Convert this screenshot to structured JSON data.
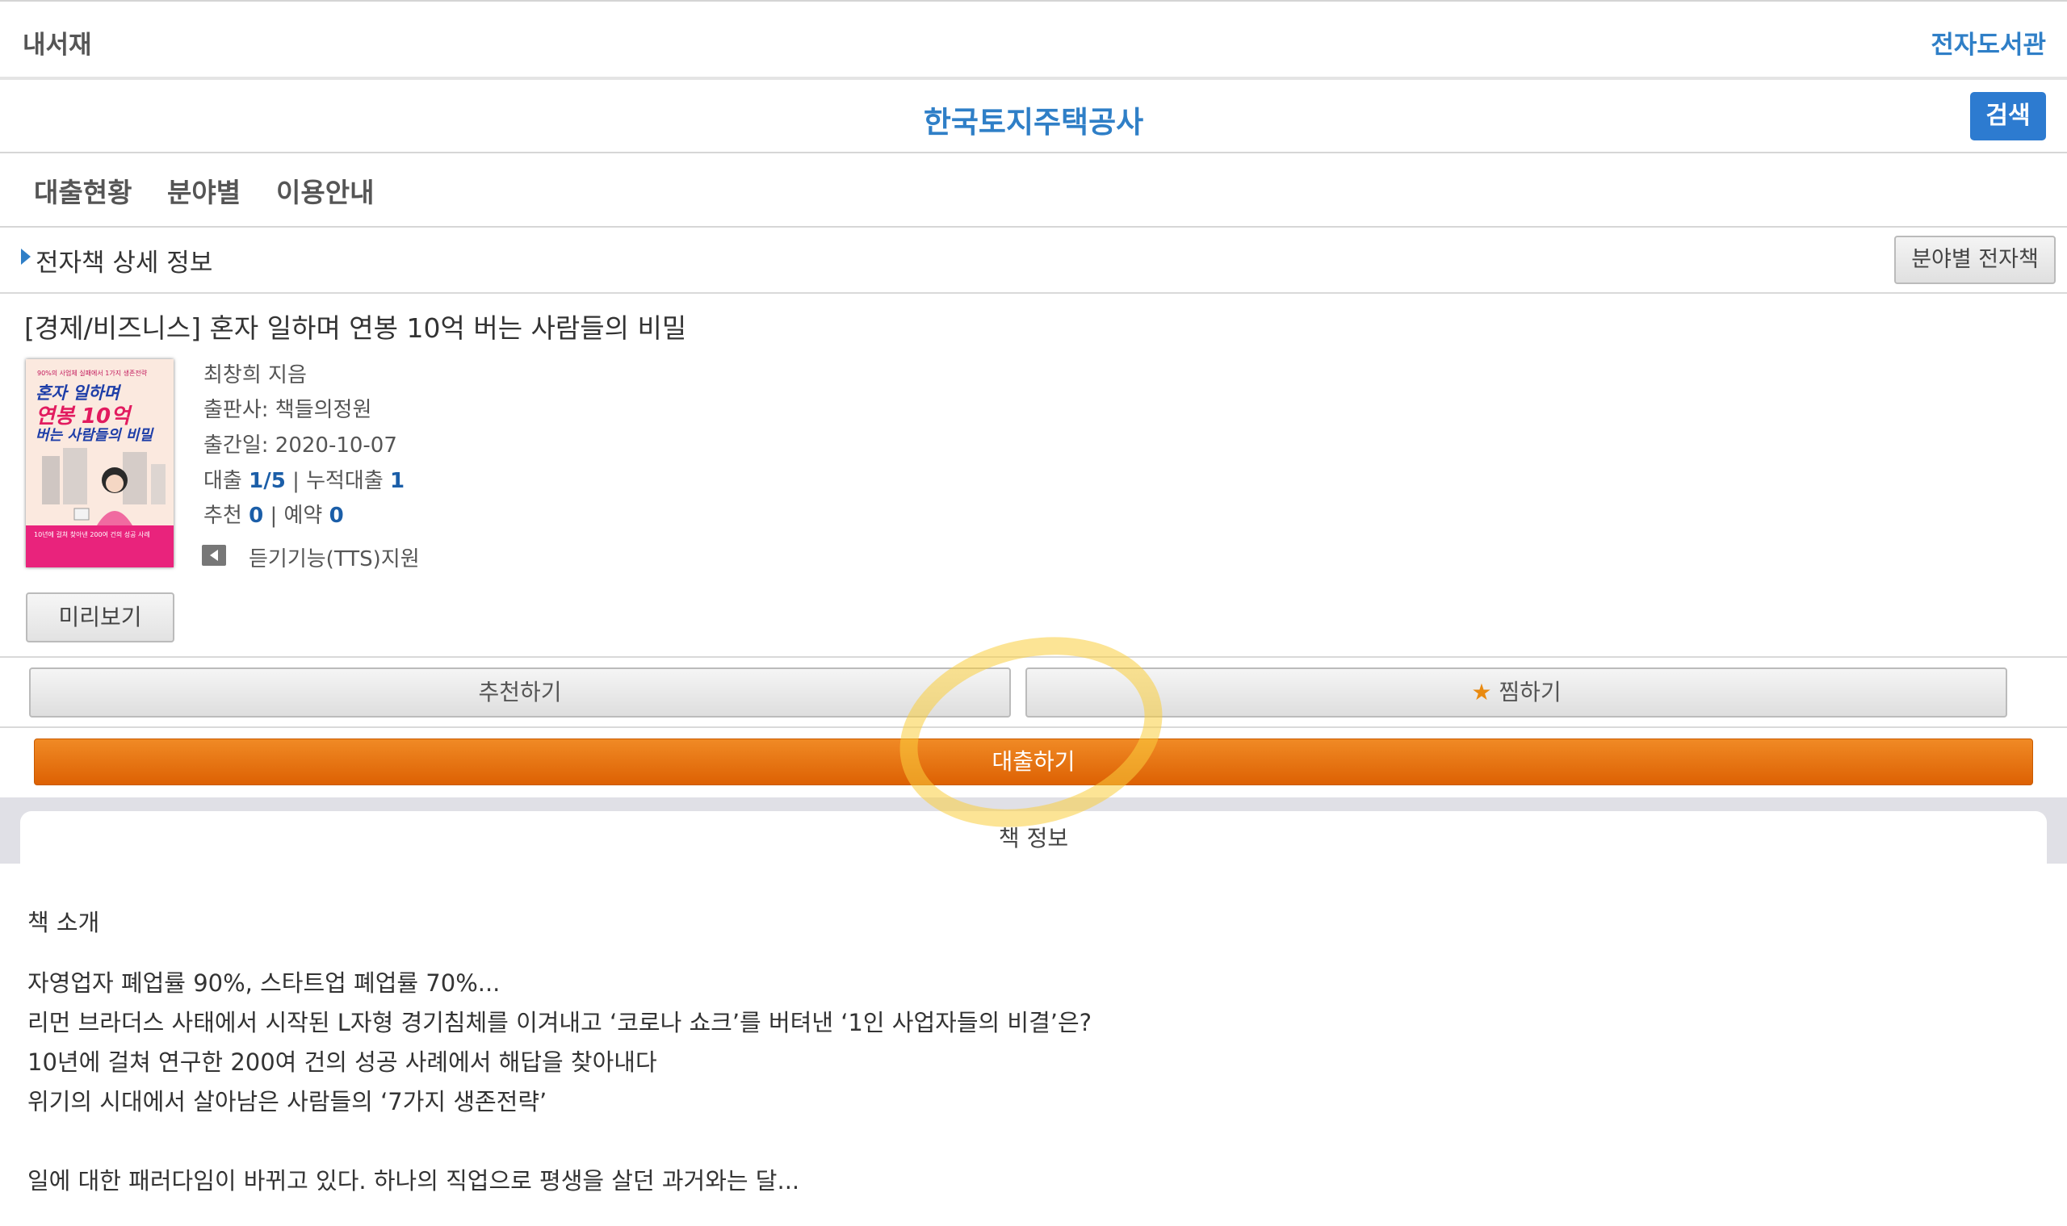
{
  "topbar": {
    "left": "내서재",
    "right": "전자도서관"
  },
  "header": {
    "title": "한국토지주택공사",
    "search_label": "검색"
  },
  "nav": {
    "items": [
      "대출현황",
      "분야별",
      "이용안내"
    ]
  },
  "section": {
    "label": "전자책 상세 정보",
    "category_button": "분야별 전자책"
  },
  "book": {
    "title": "[경제/비즈니스] 혼자 일하며 연봉 10억 버는 사람들의 비밀",
    "cover": {
      "top_text": "90%의 사업체 실패에서 1가지 생존전략",
      "line1": "혼자 일하며",
      "line2": "연봉 10억",
      "line3": "버는 사람들의 비밀",
      "bottom_text": "10년에 걸쳐 찾아낸 200여 건의 성공 사례"
    },
    "author": "최창희 지음",
    "publisher": "출판사: 책들의정원",
    "pub_date": "출간일: 2020-10-07",
    "loan_label": "대출",
    "loan_value": "1/5",
    "cumulative_label": "누적대출",
    "cumulative_value": "1",
    "recommend_label": "추천",
    "recommend_value": "0",
    "reserve_label": "예약",
    "reserve_value": "0",
    "tts": "듣기기능(TTS)지원"
  },
  "buttons": {
    "preview": "미리보기",
    "recommend": "추천하기",
    "wishlist": "찜하기",
    "borrow": "대출하기"
  },
  "tab": {
    "label": "책 정보"
  },
  "intro": {
    "heading": "책 소개",
    "lines": [
      "자영업자 폐업률 90%, 스타트업 폐업률 70%...",
      "리먼 브라더스 사태에서 시작된 L자형 경기침체를 이겨내고 ‘코로나 쇼크’를 버텨낸 ‘1인 사업자들의 비결’은?",
      "10년에 걸쳐 연구한 200여 건의 성공 사례에서 해답을 찾아내다",
      "위기의 시대에서 살아남은 사람들의 ‘7가지 생존전략’",
      "일에 대한 패러다임이 바뀌고 있다. 하나의 직업으로 평생을 살던 과거와는 달..."
    ]
  }
}
